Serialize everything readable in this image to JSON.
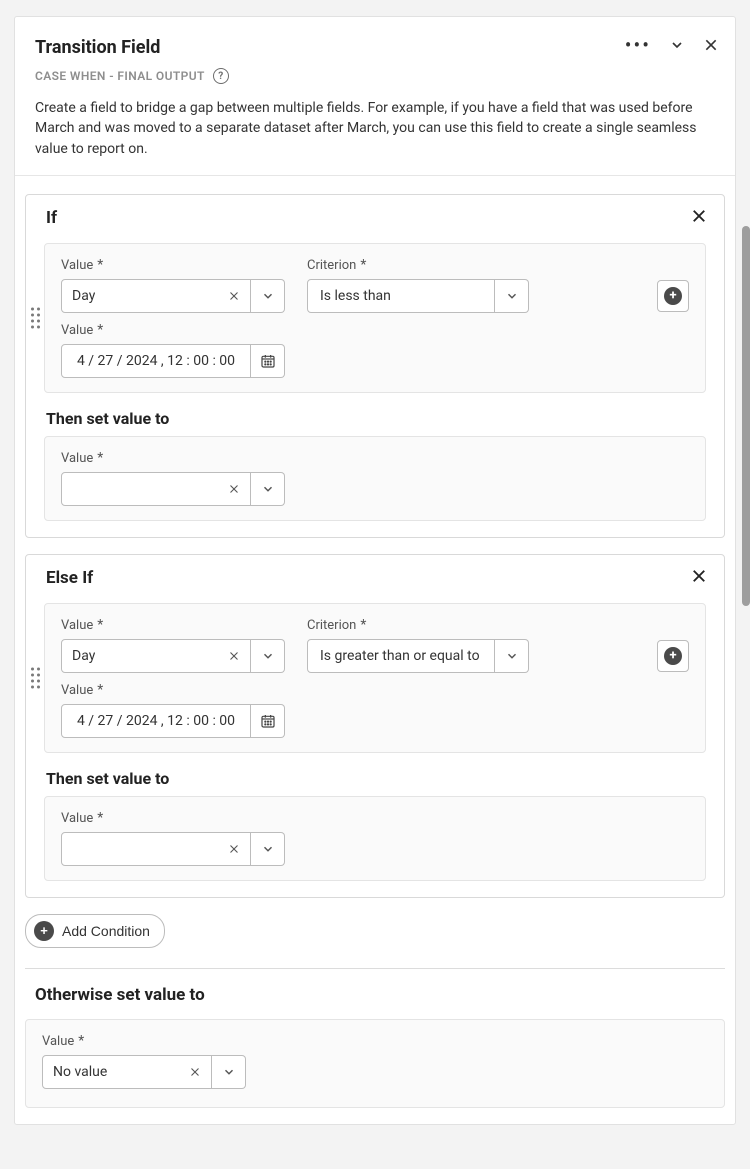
{
  "header": {
    "title": "Transition Field",
    "subtitle": "CASE WHEN - FINAL OUTPUT",
    "help_glyph": "?",
    "description": "Create a field to bridge a gap between multiple fields. For example, if you have a field that was used before March and was moved to a separate dataset after March, you can use this field to create a single seamless value to report on."
  },
  "labels": {
    "value": "Value",
    "criterion": "Criterion",
    "then_set": "Then set value to",
    "add_condition": "Add Condition",
    "otherwise": "Otherwise set value to"
  },
  "blocks": [
    {
      "title": "If",
      "source_value": "Day",
      "criterion": "Is less than",
      "comparison_date": "4 / 27 / 2024 ,   12 : 00 : 00",
      "then_value": ""
    },
    {
      "title": "Else If",
      "source_value": "Day",
      "criterion": "Is greater than or equal to",
      "comparison_date": "4 / 27 / 2024 ,   12 : 00 : 00",
      "then_value": ""
    }
  ],
  "otherwise": {
    "value": "No value"
  }
}
